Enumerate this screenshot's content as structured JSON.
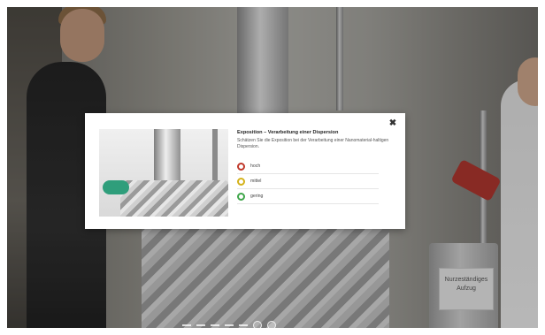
{
  "modal": {
    "close_icon": "close-icon",
    "title": "Exposition – Verarbeitung einer Dispersion",
    "question": "Schätzen Sie die Exposition bei der Verarbeitung einer Nanomaterial-haltigen Dispersion.",
    "options": [
      {
        "label": "hoch",
        "color": "#c0392b"
      },
      {
        "label": "mittel",
        "color": "#d4b21a"
      },
      {
        "label": "gering",
        "color": "#3fa64a"
      }
    ]
  },
  "background": {
    "sign_text": "Nurzeständiges Aufzug"
  },
  "colors": {
    "modal_background": "#ffffff",
    "overlay": "rgba(20,20,20,0.28)"
  }
}
